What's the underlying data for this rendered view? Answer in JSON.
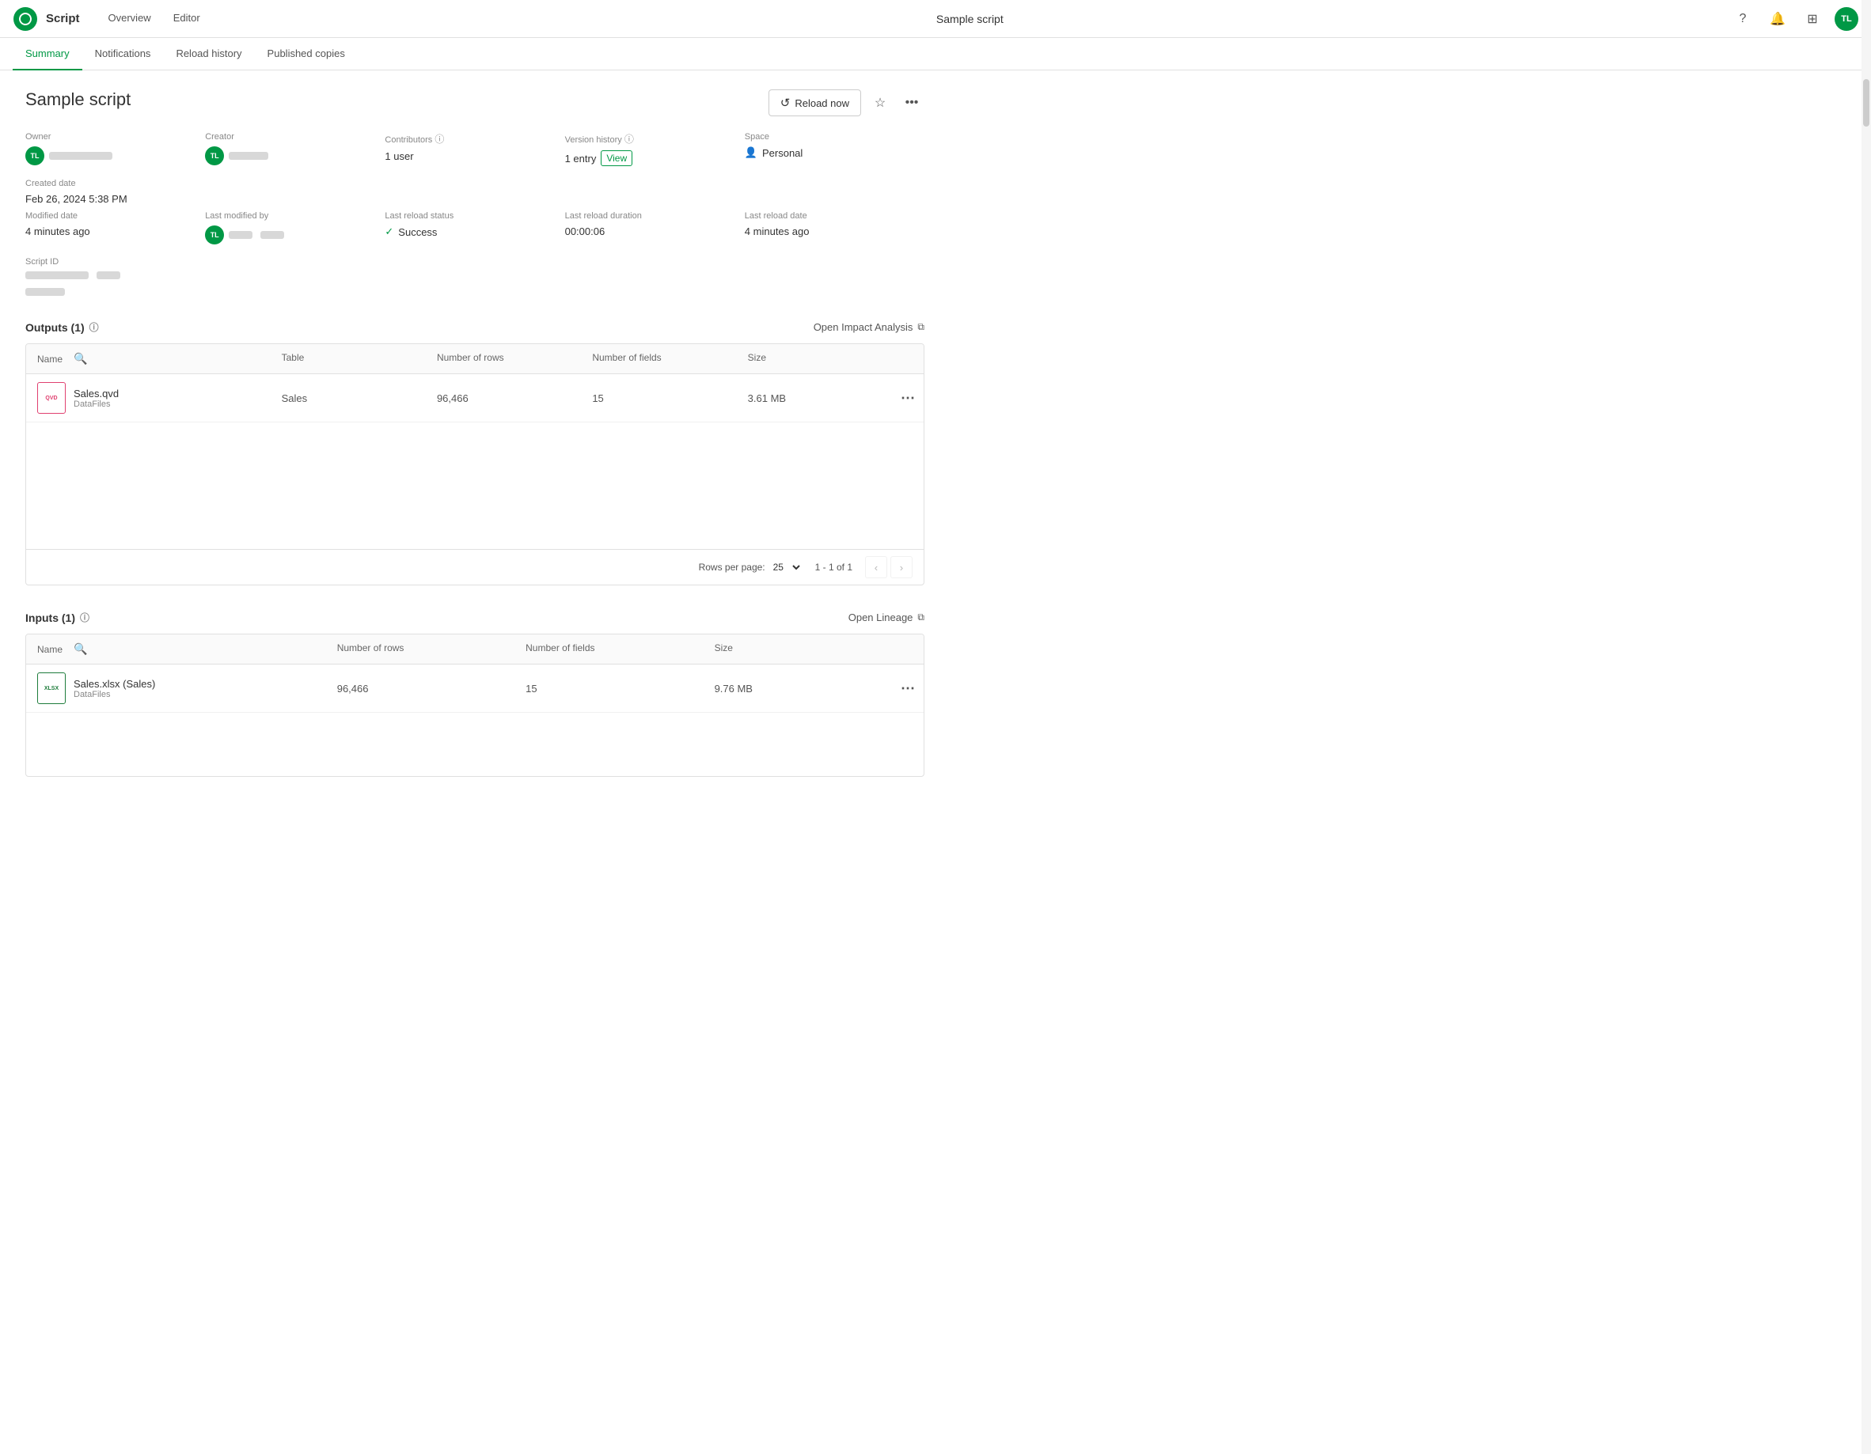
{
  "topNav": {
    "logoText": "Qlik",
    "appName": "Script",
    "navItems": [
      {
        "label": "Overview",
        "active": false
      },
      {
        "label": "Editor",
        "active": false
      }
    ],
    "centerTitle": "Sample script",
    "helpIcon": "?",
    "bellIcon": "🔔",
    "gridIcon": "⊞",
    "avatarText": "TL"
  },
  "subTabs": [
    {
      "label": "Summary",
      "active": true
    },
    {
      "label": "Notifications",
      "active": false
    },
    {
      "label": "Reload history",
      "active": false
    },
    {
      "label": "Published copies",
      "active": false
    }
  ],
  "scriptTitle": "Sample script",
  "headerActions": {
    "reloadNow": "Reload now",
    "starIcon": "☆",
    "moreIcon": "…"
  },
  "meta": {
    "owner": {
      "label": "Owner",
      "avatarText": "TL"
    },
    "creator": {
      "label": "Creator",
      "avatarText": "TL"
    },
    "contributors": {
      "label": "Contributors",
      "value": "1 user",
      "infoIcon": "ⓘ"
    },
    "versionHistory": {
      "label": "Version history",
      "entry": "1 entry",
      "viewLabel": "View",
      "infoIcon": "ⓘ"
    },
    "space": {
      "label": "Space",
      "value": "Personal"
    },
    "createdDate": {
      "label": "Created date",
      "value": "Feb 26, 2024 5:38 PM"
    },
    "modifiedDate": {
      "label": "Modified date",
      "value": "4 minutes ago"
    },
    "lastModifiedBy": {
      "label": "Last modified by",
      "avatarText": "TL"
    },
    "lastReloadStatus": {
      "label": "Last reload status",
      "value": "Success"
    },
    "lastReloadDuration": {
      "label": "Last reload duration",
      "value": "00:00:06"
    },
    "lastReloadDate": {
      "label": "Last reload date",
      "value": "4 minutes ago"
    },
    "scriptId": {
      "label": "Script ID"
    }
  },
  "outputs": {
    "sectionTitle": "Outputs (1)",
    "infoIcon": "ⓘ",
    "actionLabel": "Open Impact Analysis",
    "tableHeaders": {
      "name": "Name",
      "table": "Table",
      "rows": "Number of rows",
      "fields": "Number of fields",
      "size": "Size"
    },
    "rows": [
      {
        "fileName": "Sales.qvd",
        "filePath": "DataFiles",
        "fileType": "QVD",
        "table": "Sales",
        "rows": "96,466",
        "fields": "15",
        "size": "3.61 MB"
      }
    ],
    "footer": {
      "rowsPerPageLabel": "Rows per page:",
      "rowsPerPageValue": "25",
      "pageInfo": "1 - 1 of 1"
    }
  },
  "inputs": {
    "sectionTitle": "Inputs (1)",
    "infoIcon": "ⓘ",
    "actionLabel": "Open Lineage",
    "tableHeaders": {
      "name": "Name",
      "rows": "Number of rows",
      "fields": "Number of fields",
      "size": "Size"
    },
    "rows": [
      {
        "fileName": "Sales.xlsx (Sales)",
        "filePath": "DataFiles",
        "fileType": "XLSX",
        "rows": "96,466",
        "fields": "15",
        "size": "9.76 MB"
      }
    ]
  }
}
